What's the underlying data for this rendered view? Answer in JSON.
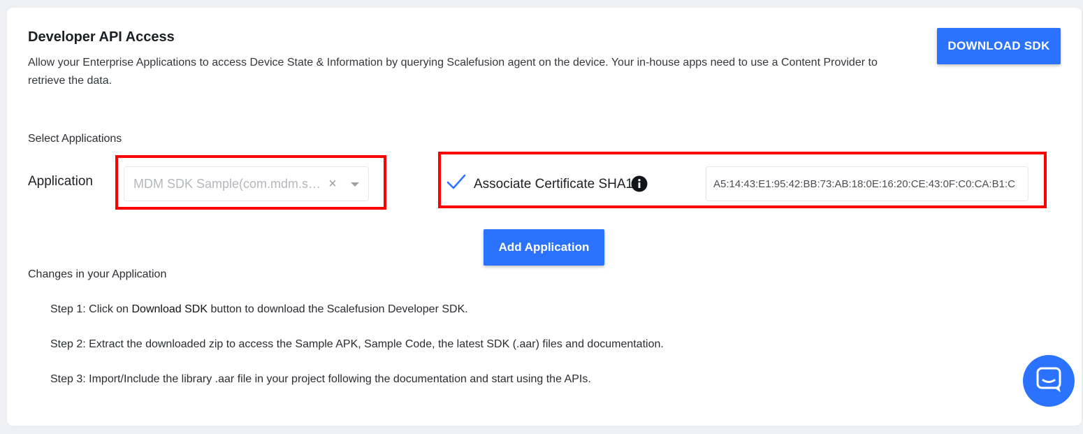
{
  "header": {
    "title": "Developer API Access",
    "description": "Allow your Enterprise Applications to access Device State & Information by querying Scalefusion agent on the device. Your in-house apps need to use a Content Provider to retrieve the data.",
    "download_button_label": "DOWNLOAD SDK"
  },
  "select_applications": {
    "section_label": "Select Applications",
    "application_label": "Application",
    "application_value": "MDM SDK Sample(com.mdm.sdk.sample)",
    "clear_glyph": "×",
    "associate_certificate_label": "Associate Certificate SHA1",
    "associate_certificate_checked": true,
    "sha1_value": "A5:14:43:E1:95:42:BB:73:AB:18:0E:16:20:CE:43:0F:C0:CA:B1:C",
    "add_button_label": "Add Application"
  },
  "changes": {
    "section_label": "Changes in your Application",
    "steps": [
      {
        "prefix": "Step 1: Click on ",
        "bold": "Download SDK",
        "suffix": " button to download the Scalefusion Developer SDK."
      },
      {
        "text": "Step 2: Extract the downloaded zip to access the Sample APK, Sample Code, the latest SDK (.aar) files and documentation."
      },
      {
        "text": "Step 3: Import/Include the library .aar file in your project following the documentation and start using the APIs."
      }
    ]
  },
  "icons": {
    "check": "check-icon",
    "info": "info-icon",
    "clear": "clear-icon",
    "caret": "chevron-down-icon",
    "chat": "chat-icon"
  },
  "colors": {
    "primary": "#2b72ff",
    "highlight": "#ff0000",
    "background": "#eef0f3"
  }
}
